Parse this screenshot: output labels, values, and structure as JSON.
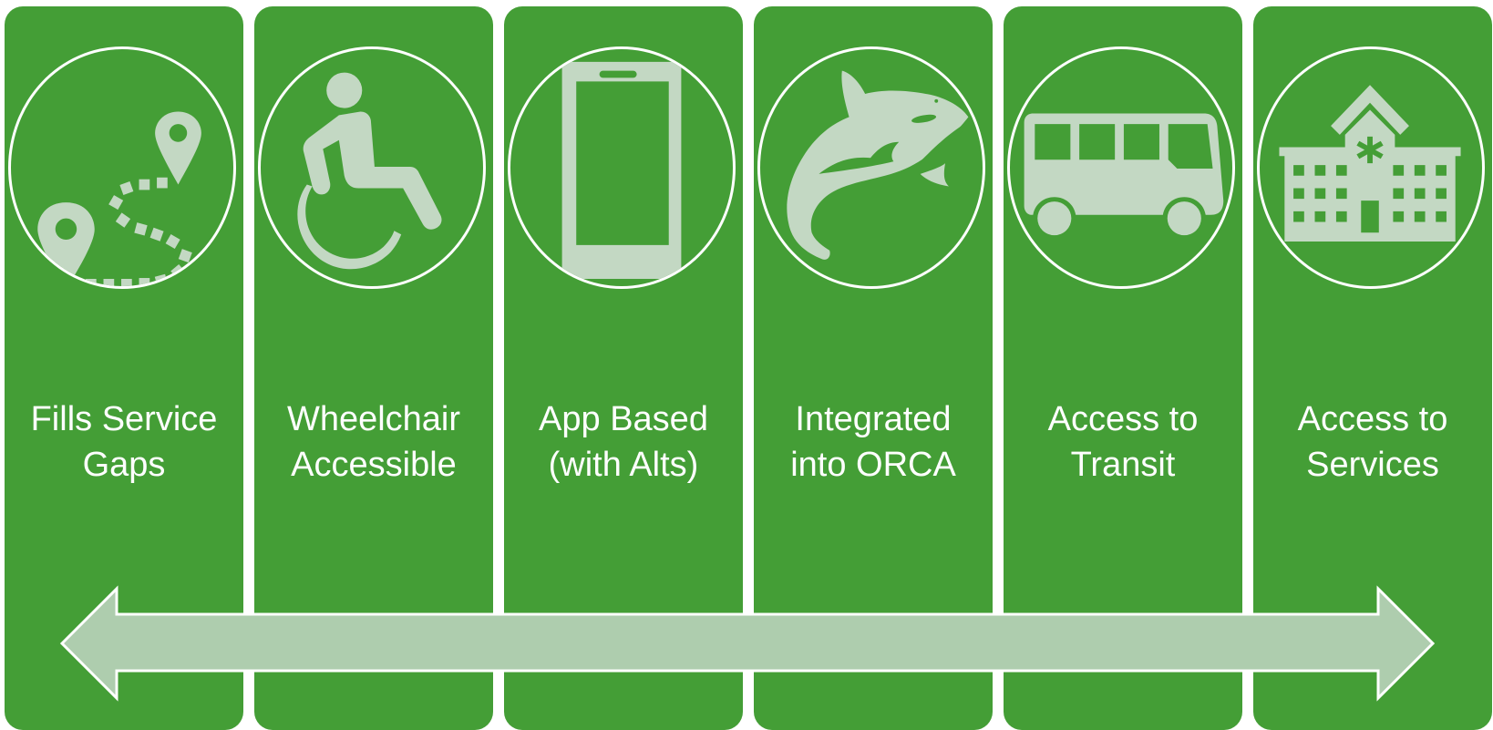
{
  "colors": {
    "column_fill": "#449E36",
    "icon_fill": "#C3D8C3",
    "arrow_fill": "#AECDAE",
    "outline": "#FFFFFF"
  },
  "columns": [
    {
      "icon": "map-route-icon",
      "line1": "Fills Service",
      "line2": "Gaps"
    },
    {
      "icon": "wheelchair-icon",
      "line1": "Wheelchair",
      "line2": "Accessible"
    },
    {
      "icon": "smartphone-icon",
      "line1": "App Based",
      "line2": "(with Alts)"
    },
    {
      "icon": "orca-whale-icon",
      "line1": "Integrated",
      "line2": "into ORCA"
    },
    {
      "icon": "bus-icon",
      "line1": "Access to",
      "line2": "Transit"
    },
    {
      "icon": "hospital-icon",
      "line1": "Access to",
      "line2": "Services"
    }
  ]
}
